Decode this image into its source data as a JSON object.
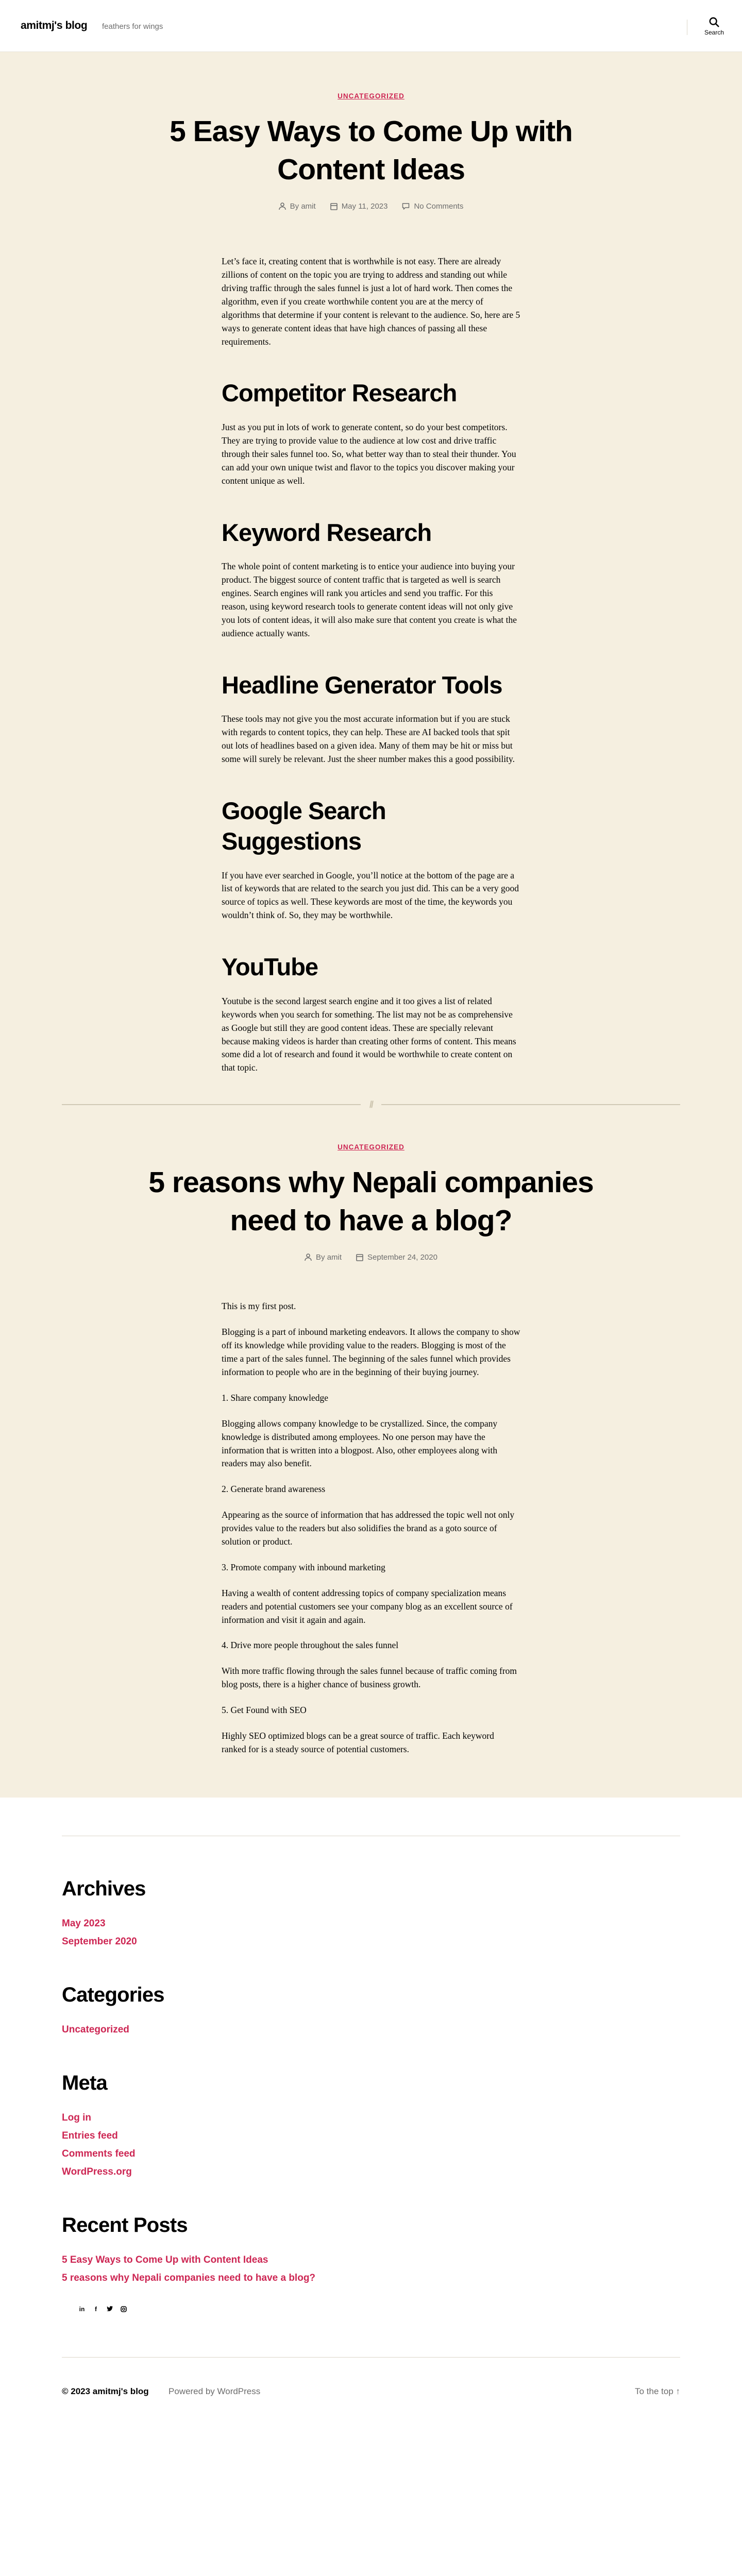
{
  "header": {
    "site_title": "amitmj's blog",
    "site_description": "feathers for wings",
    "search_label": "Search"
  },
  "posts": [
    {
      "category": "UNCATEGORIZED",
      "title": "5 Easy Ways to Come Up with Content Ideas",
      "author": "By amit",
      "date": "May 11, 2023",
      "comments": "No Comments",
      "intro": "Let’s face it, creating content that is worthwhile is not easy. There are already zillions of content on the topic you are trying to address and standing out while driving traffic through the sales funnel is just a lot of hard work. Then comes the algorithm, even if you create worthwhile content you are at the mercy of algorithms that determine if your content is relevant to the audience. So, here are 5 ways to generate content ideas that have high chances of passing all these requirements.",
      "sections": [
        {
          "heading": "Competitor Research",
          "text": "Just as you put in lots of work to generate content, so do your best competitors. They are trying to provide value to the audience at low cost and drive traffic through their sales funnel too. So, what better way than to steal their thunder. You can add your own unique twist and flavor to the topics you discover making your content unique as well."
        },
        {
          "heading": "Keyword Research",
          "text": "The whole point of content marketing is to entice your audience into buying your product. The biggest source of content traffic that is targeted as well is search engines. Search engines will rank you articles and send you traffic. For this reason, using keyword research tools to generate content ideas will not only give you lots of content ideas, it will also make sure that content you create is what the audience actually wants."
        },
        {
          "heading": "Headline Generator Tools",
          "text": "These tools may not give you the most accurate information but if you are stuck with regards to content topics, they can help. These are AI backed tools that spit out lots of headlines based on a given idea. Many of them may be hit or miss but some will surely be relevant. Just the sheer number makes this a good possibility."
        },
        {
          "heading": "Google Search Suggestions",
          "text": "If you have ever searched in Google, you’ll notice at the bottom of the page are a list of keywords that are related to the search you just did. This can be a very good source of topics as well. These keywords are most of the time, the keywords you wouldn’t think of. So, they may be worthwhile."
        },
        {
          "heading": "YouTube",
          "text": "Youtube is the second largest search engine and it too gives a list of related keywords when you search for something. The list may not be as comprehensive as Google but still they are good content ideas. These are specially relevant because making videos is harder than creating other forms of content. This means some did a lot of research and found it would be worthwhile to create content on that topic."
        }
      ]
    },
    {
      "category": "UNCATEGORIZED",
      "title": "5 reasons why Nepali companies need to have a blog?",
      "author": "By amit",
      "date": "September 24, 2020",
      "paragraphs": [
        "This is my first post.",
        "Blogging is a part of inbound marketing endeavors. It allows the company to show off its knowledge while providing value to the readers. Blogging is most of the time a part of the sales funnel. The beginning of the sales funnel which provides information to people who are in the beginning of their buying journey.",
        "1. Share company knowledge",
        "Blogging allows company knowledge to be crystallized. Since, the company knowledge is distributed among employees. No one person may have the information that is written into a blogpost. Also, other employees along with readers may also benefit.",
        "2. Generate brand awareness",
        "Appearing as the source of information that has addressed the topic well not only provides value to the readers but also solidifies the brand as a goto source of solution or product.",
        "3. Promote company with inbound marketing",
        "Having a wealth of content addressing topics of company specialization means readers and potential customers see your company blog as an excellent source of information and visit it again and again.",
        "4. Drive more people throughout the sales funnel",
        "With more traffic flowing through the sales funnel because of traffic coming from blog posts, there is a higher chance of business growth.",
        "5. Get Found with SEO",
        "Highly SEO optimized blogs can be a great source of traffic. Each keyword ranked for is a steady source of potential customers."
      ]
    }
  ],
  "separator_mark": "//",
  "widgets": {
    "archives": {
      "title": "Archives",
      "items": [
        "May 2023",
        "September 2020"
      ]
    },
    "categories": {
      "title": "Categories",
      "items": [
        "Uncategorized"
      ]
    },
    "meta": {
      "title": "Meta",
      "items": [
        "Log in",
        "Entries feed",
        "Comments feed",
        "WordPress.org"
      ]
    },
    "recent": {
      "title": "Recent Posts",
      "items": [
        "5 Easy Ways to Come Up with Content Ideas",
        "5 reasons why Nepali companies need to have a blog?"
      ]
    }
  },
  "social_icons": [
    "linkedin-icon",
    "facebook-icon",
    "twitter-icon",
    "instagram-icon"
  ],
  "footer": {
    "copyright": "© 2023 amitmj's blog",
    "powered": "Powered by WordPress",
    "to_top": "To the top ↑"
  },
  "colors": {
    "accent": "#cd2653",
    "background": "#f5efe0",
    "muted": "#6d6d6d"
  }
}
